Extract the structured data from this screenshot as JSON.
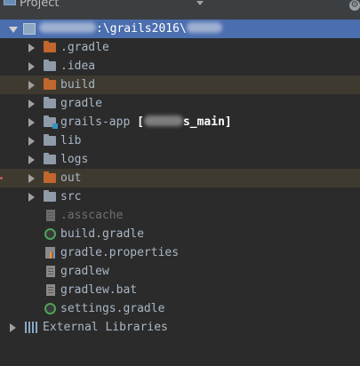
{
  "panel": {
    "title": "Project",
    "gear_glyph": "⚙"
  },
  "colors": {
    "background": "#2b2b2b",
    "selection": "#4b6eaf",
    "excluded_folder": "#c1662e",
    "folder": "#8f9ba8",
    "text": "#a9b7c6"
  },
  "tree": {
    "root": {
      "label_path": ":\\grails2016\\",
      "icon": "module-folder-icon",
      "expanded": true,
      "selected": true
    },
    "items": [
      {
        "label": ".gradle",
        "icon": "excluded-folder-icon",
        "expandable": true
      },
      {
        "label": ".idea",
        "icon": "folder-icon",
        "expandable": true
      },
      {
        "label": "build",
        "icon": "excluded-folder-icon",
        "expandable": true
      },
      {
        "label": "gradle",
        "icon": "folder-icon",
        "expandable": true
      },
      {
        "label": "grails-app",
        "bracket_open": "[",
        "module_suffix": "s_main]",
        "icon": "module-folder-icon",
        "expandable": true
      },
      {
        "label": "lib",
        "icon": "folder-icon",
        "expandable": true
      },
      {
        "label": "logs",
        "icon": "folder-icon",
        "expandable": true
      },
      {
        "label": "out",
        "icon": "excluded-folder-icon",
        "expandable": true
      },
      {
        "label": "src",
        "icon": "folder-icon",
        "expandable": true
      },
      {
        "label": ".asscache",
        "icon": "file-icon",
        "expandable": false
      },
      {
        "label": "build.gradle",
        "icon": "gradle-icon",
        "expandable": false
      },
      {
        "label": "gradle.properties",
        "icon": "properties-file-icon",
        "expandable": false
      },
      {
        "label": "gradlew",
        "icon": "file-icon",
        "expandable": false
      },
      {
        "label": "gradlew.bat",
        "icon": "file-icon",
        "expandable": false
      },
      {
        "label": "settings.gradle",
        "icon": "gradle-icon",
        "expandable": false
      }
    ],
    "external_libraries": {
      "label": "External Libraries",
      "icon": "library-icon",
      "expandable": true
    }
  }
}
